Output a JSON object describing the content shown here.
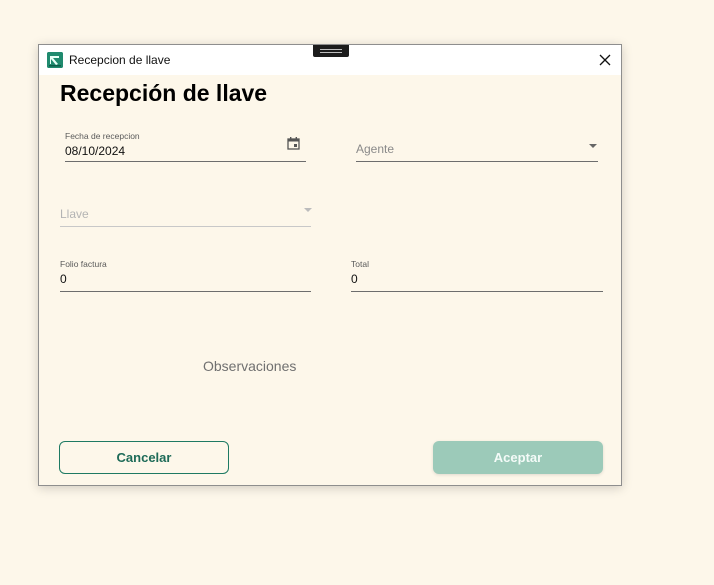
{
  "window": {
    "title": "Recepcion de llave",
    "icon": "app-logo-icon",
    "accent_color": "#1f8a6e"
  },
  "page": {
    "heading": "Recepción de llave"
  },
  "form": {
    "fecha": {
      "label": "Fecha de recepcion",
      "value": "08/10/2024",
      "icon": "calendar-icon"
    },
    "agente": {
      "placeholder": "Agente"
    },
    "llave": {
      "placeholder": "Llave",
      "disabled": true
    },
    "folio": {
      "label": "Folio factura",
      "value": "0"
    },
    "total": {
      "label": "Total",
      "value": "0"
    },
    "observaciones": {
      "placeholder": "Observaciones"
    }
  },
  "actions": {
    "cancel_label": "Cancelar",
    "accept_label": "Aceptar",
    "cancel_color": "#1e7a63",
    "accept_color": "#9ccab9"
  }
}
